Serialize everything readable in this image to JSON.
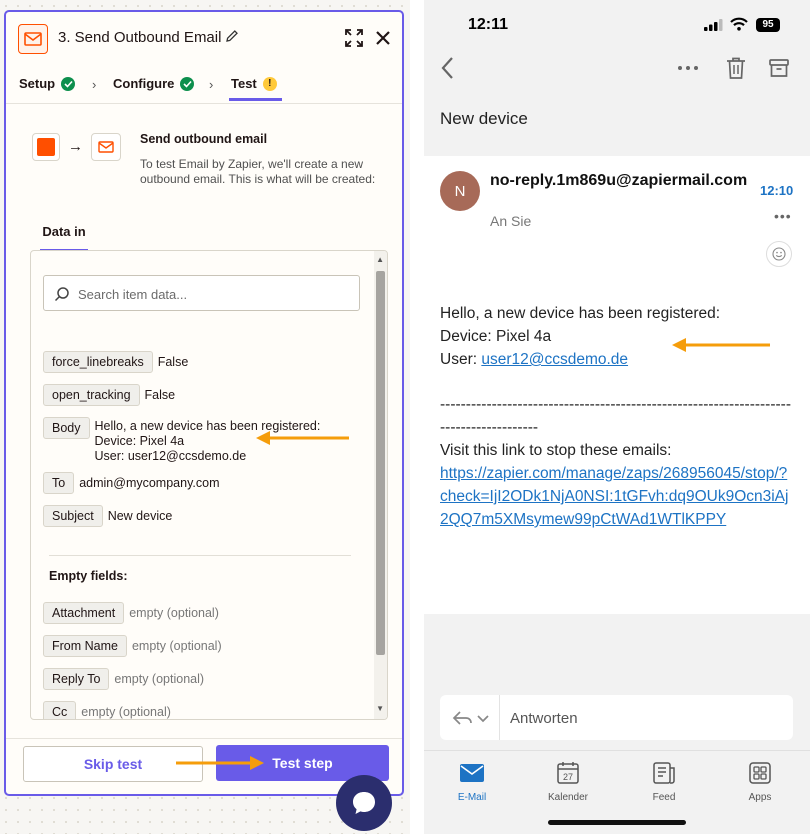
{
  "zapier": {
    "step_title": "3. Send Outbound Email",
    "tabs": [
      {
        "label": "Setup",
        "status": "complete"
      },
      {
        "label": "Configure",
        "status": "complete"
      },
      {
        "label": "Test",
        "status": "warning",
        "warning_glyph": "!"
      }
    ],
    "step_name": "Send outbound email",
    "step_description": "To test Email by Zapier, we'll create a new outbound email. This is what will be created:",
    "data_tab": "Data in",
    "search_placeholder": "Search item data...",
    "fields": [
      {
        "key": "force_linebreaks",
        "value": "False"
      },
      {
        "key": "open_tracking",
        "value": "False"
      },
      {
        "key": "Body",
        "lines": [
          "Hello, a new device has been registered:",
          "Device: Pixel 4a",
          "User: user12@ccsdemo.de"
        ]
      },
      {
        "key": "To",
        "value": "admin@mycompany.com"
      },
      {
        "key": "Subject",
        "value": "New device"
      }
    ],
    "empty_heading": "Empty fields:",
    "empty_fields": [
      {
        "key": "Attachment",
        "value": "empty (optional)"
      },
      {
        "key": "From Name",
        "value": "empty (optional)"
      },
      {
        "key": "Reply To",
        "value": "empty (optional)"
      },
      {
        "key": "Cc",
        "value": "empty (optional)"
      }
    ],
    "skip_label": "Skip test",
    "test_label": "Test step",
    "colors": {
      "accent": "#695be8",
      "brand": "#ff4f00",
      "success": "#0d8f4d",
      "warning": "#ffc93a",
      "annotation": "#f59d0b"
    }
  },
  "phone": {
    "time": "12:11",
    "battery": "95",
    "subject": "New device",
    "avatar_initial": "N",
    "sender": "no-reply.1m869u@zapiermail.com",
    "recipient": "An Sie",
    "received_time": "12:10",
    "body_lines": [
      "Hello, a new device has been registered:",
      "Device: Pixel 4a"
    ],
    "user_prefix": "User: ",
    "user_email": "user12@ccsdemo.de",
    "separator": "---------------------------------------------------------------------------------------",
    "unsubscribe_text": "Visit this link to stop these emails:",
    "unsubscribe_link": "https://zapier.com/manage/zaps/268956045/stop/?check=IjI2ODk1NjA0NSI:1tGFvh:dq9OUk9Ocn3iAj2QQ7m5XMsymew99pCtWAd1WTlKPPY",
    "reply_placeholder": "Antworten",
    "tabs": [
      {
        "label": "E-Mail",
        "icon": "mail-icon",
        "active": true
      },
      {
        "label": "Kalender",
        "icon": "calendar-icon",
        "day": "27",
        "active": false
      },
      {
        "label": "Feed",
        "icon": "feed-icon",
        "active": false
      },
      {
        "label": "Apps",
        "icon": "apps-grid-icon",
        "active": false
      }
    ],
    "colors": {
      "link": "#1d73c4",
      "avatar": "#a76a58"
    }
  }
}
